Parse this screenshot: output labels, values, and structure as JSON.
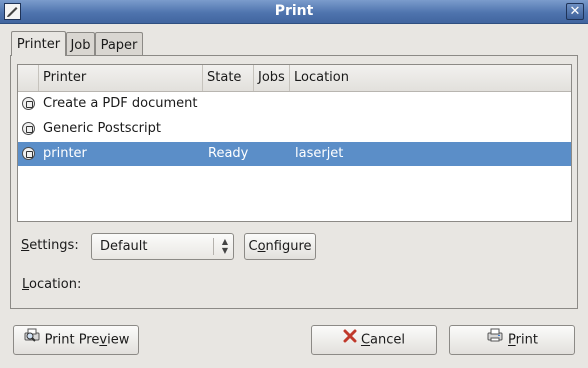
{
  "window": {
    "title": "Print",
    "close_glyph": "✕"
  },
  "tabs": [
    {
      "label": "Printer",
      "active": true
    },
    {
      "label": "Job",
      "active": false
    },
    {
      "label": "Paper",
      "active": false
    }
  ],
  "printer_list": {
    "columns": [
      "Printer",
      "State",
      "Jobs",
      "Location"
    ],
    "rows": [
      {
        "icon": "printer-icon",
        "name": "Create a PDF document",
        "state": "",
        "jobs": "",
        "location": "",
        "selected": false
      },
      {
        "icon": "printer-icon",
        "name": "Generic Postscript",
        "state": "",
        "jobs": "",
        "location": "",
        "selected": false
      },
      {
        "icon": "printer-icon",
        "name": "printer",
        "state": "Ready",
        "jobs": "",
        "location": "laserjet",
        "selected": true
      }
    ]
  },
  "settings": {
    "label_pre": "",
    "label_mnemonic": "S",
    "label_post": "ettings:",
    "value": "Default"
  },
  "configure": {
    "label_pre": "C",
    "label_mnemonic": "o",
    "label_post": "nfigure"
  },
  "location": {
    "label_pre": "",
    "label_mnemonic": "L",
    "label_post": "ocation:",
    "value": ""
  },
  "buttons": {
    "preview": {
      "label_pre": "Print Pre",
      "label_mnemonic": "v",
      "label_post": "iew"
    },
    "cancel": {
      "label_pre": "",
      "label_mnemonic": "C",
      "label_post": "ancel"
    },
    "print": {
      "label_pre": "",
      "label_mnemonic": "P",
      "label_post": "rint"
    }
  },
  "colors": {
    "selection": "#5b8ec8",
    "titlebar": "#4f74ae",
    "cancel_icon": "#c0392b"
  }
}
